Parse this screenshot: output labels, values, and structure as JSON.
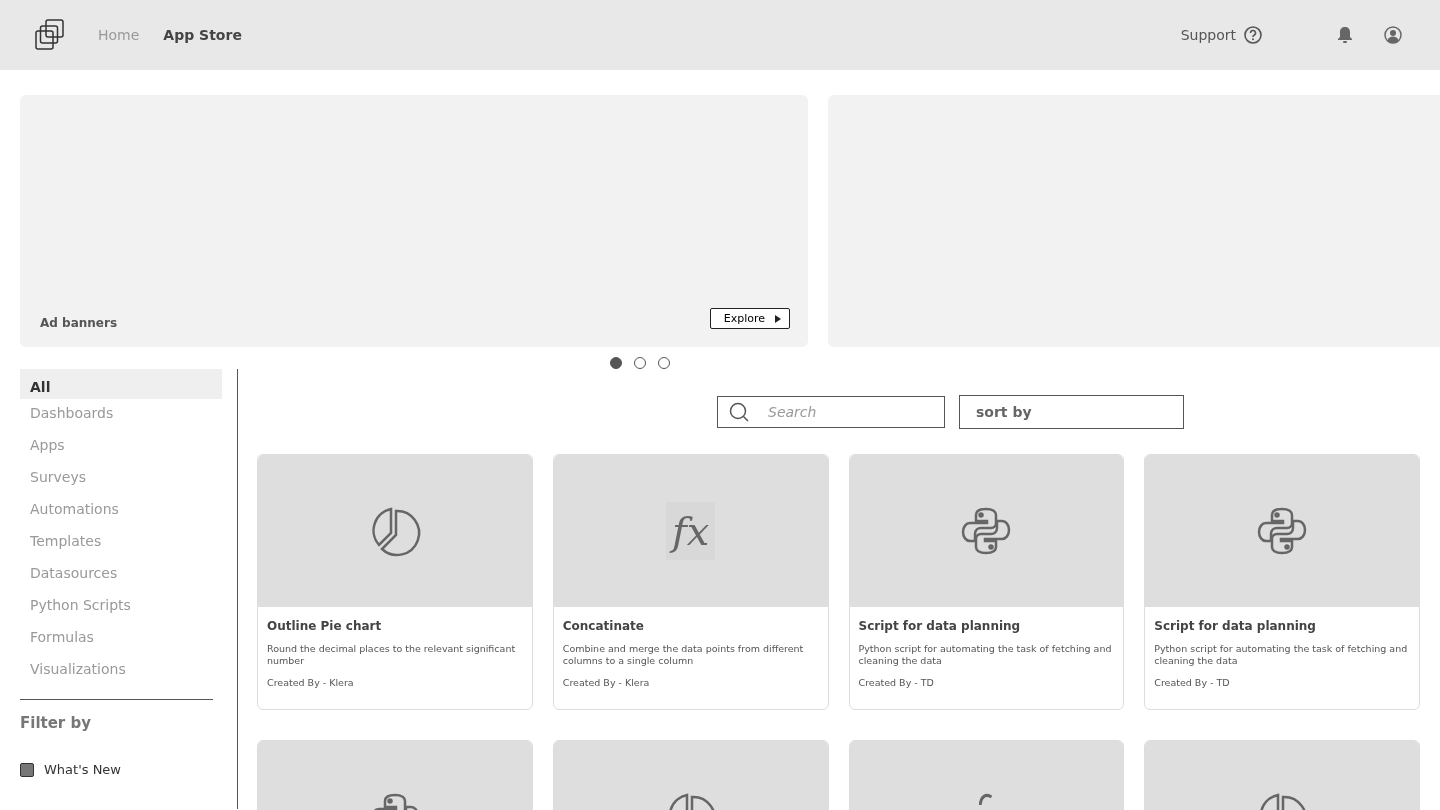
{
  "nav": {
    "links": [
      {
        "label": "Home",
        "selected": false
      },
      {
        "label": "App Store",
        "selected": true
      }
    ],
    "support": "Support"
  },
  "banners": [
    {
      "kind": "ad",
      "label": "Ad banners",
      "button": "Explore"
    },
    {
      "kind": "ad"
    }
  ],
  "carousel": [
    {
      "selected": true
    },
    {
      "selected": false
    },
    {
      "selected": false
    }
  ],
  "sidebar": {
    "items": [
      {
        "label": "All",
        "selected": true
      },
      {
        "label": "Dashboards",
        "selected": false
      },
      {
        "label": "Apps",
        "selected": false
      },
      {
        "label": "Surveys",
        "selected": false
      },
      {
        "label": "Automations",
        "selected": false
      },
      {
        "label": "Templates",
        "selected": false
      },
      {
        "label": "Datasources",
        "selected": false
      },
      {
        "label": "Python Scripts",
        "selected": false
      },
      {
        "label": "Formulas",
        "selected": false
      },
      {
        "label": "Visualizations",
        "selected": false
      }
    ],
    "filter_title": "Filter by",
    "filters": [
      {
        "label": "What's New",
        "checked": true
      }
    ]
  },
  "search": {
    "placeholder": "Search"
  },
  "sort": {
    "placeholder": "sort by"
  },
  "cards": [
    {
      "kind": "pie",
      "title": "Outline Pie chart",
      "description": "Round the decimal places to the relevant significant number",
      "author": "Created By - Klera"
    },
    {
      "kind": "formula",
      "glyph": "fx",
      "title": "Concatinate",
      "description": "Combine and merge the data points from different columns to a single column",
      "author": "Created By - Klera"
    },
    {
      "kind": "python",
      "title": "Script for data planning",
      "description": "Python script for automating the task of fetching and cleaning the data",
      "author": "Created By - TD"
    },
    {
      "kind": "python",
      "title": "Script for data planning",
      "description": "Python script for automating the task of fetching and cleaning the data",
      "author": "Created By - TD"
    },
    {
      "kind": "python"
    },
    {
      "kind": "pie"
    },
    {
      "kind": "formula"
    },
    {
      "kind": "pie"
    }
  ]
}
